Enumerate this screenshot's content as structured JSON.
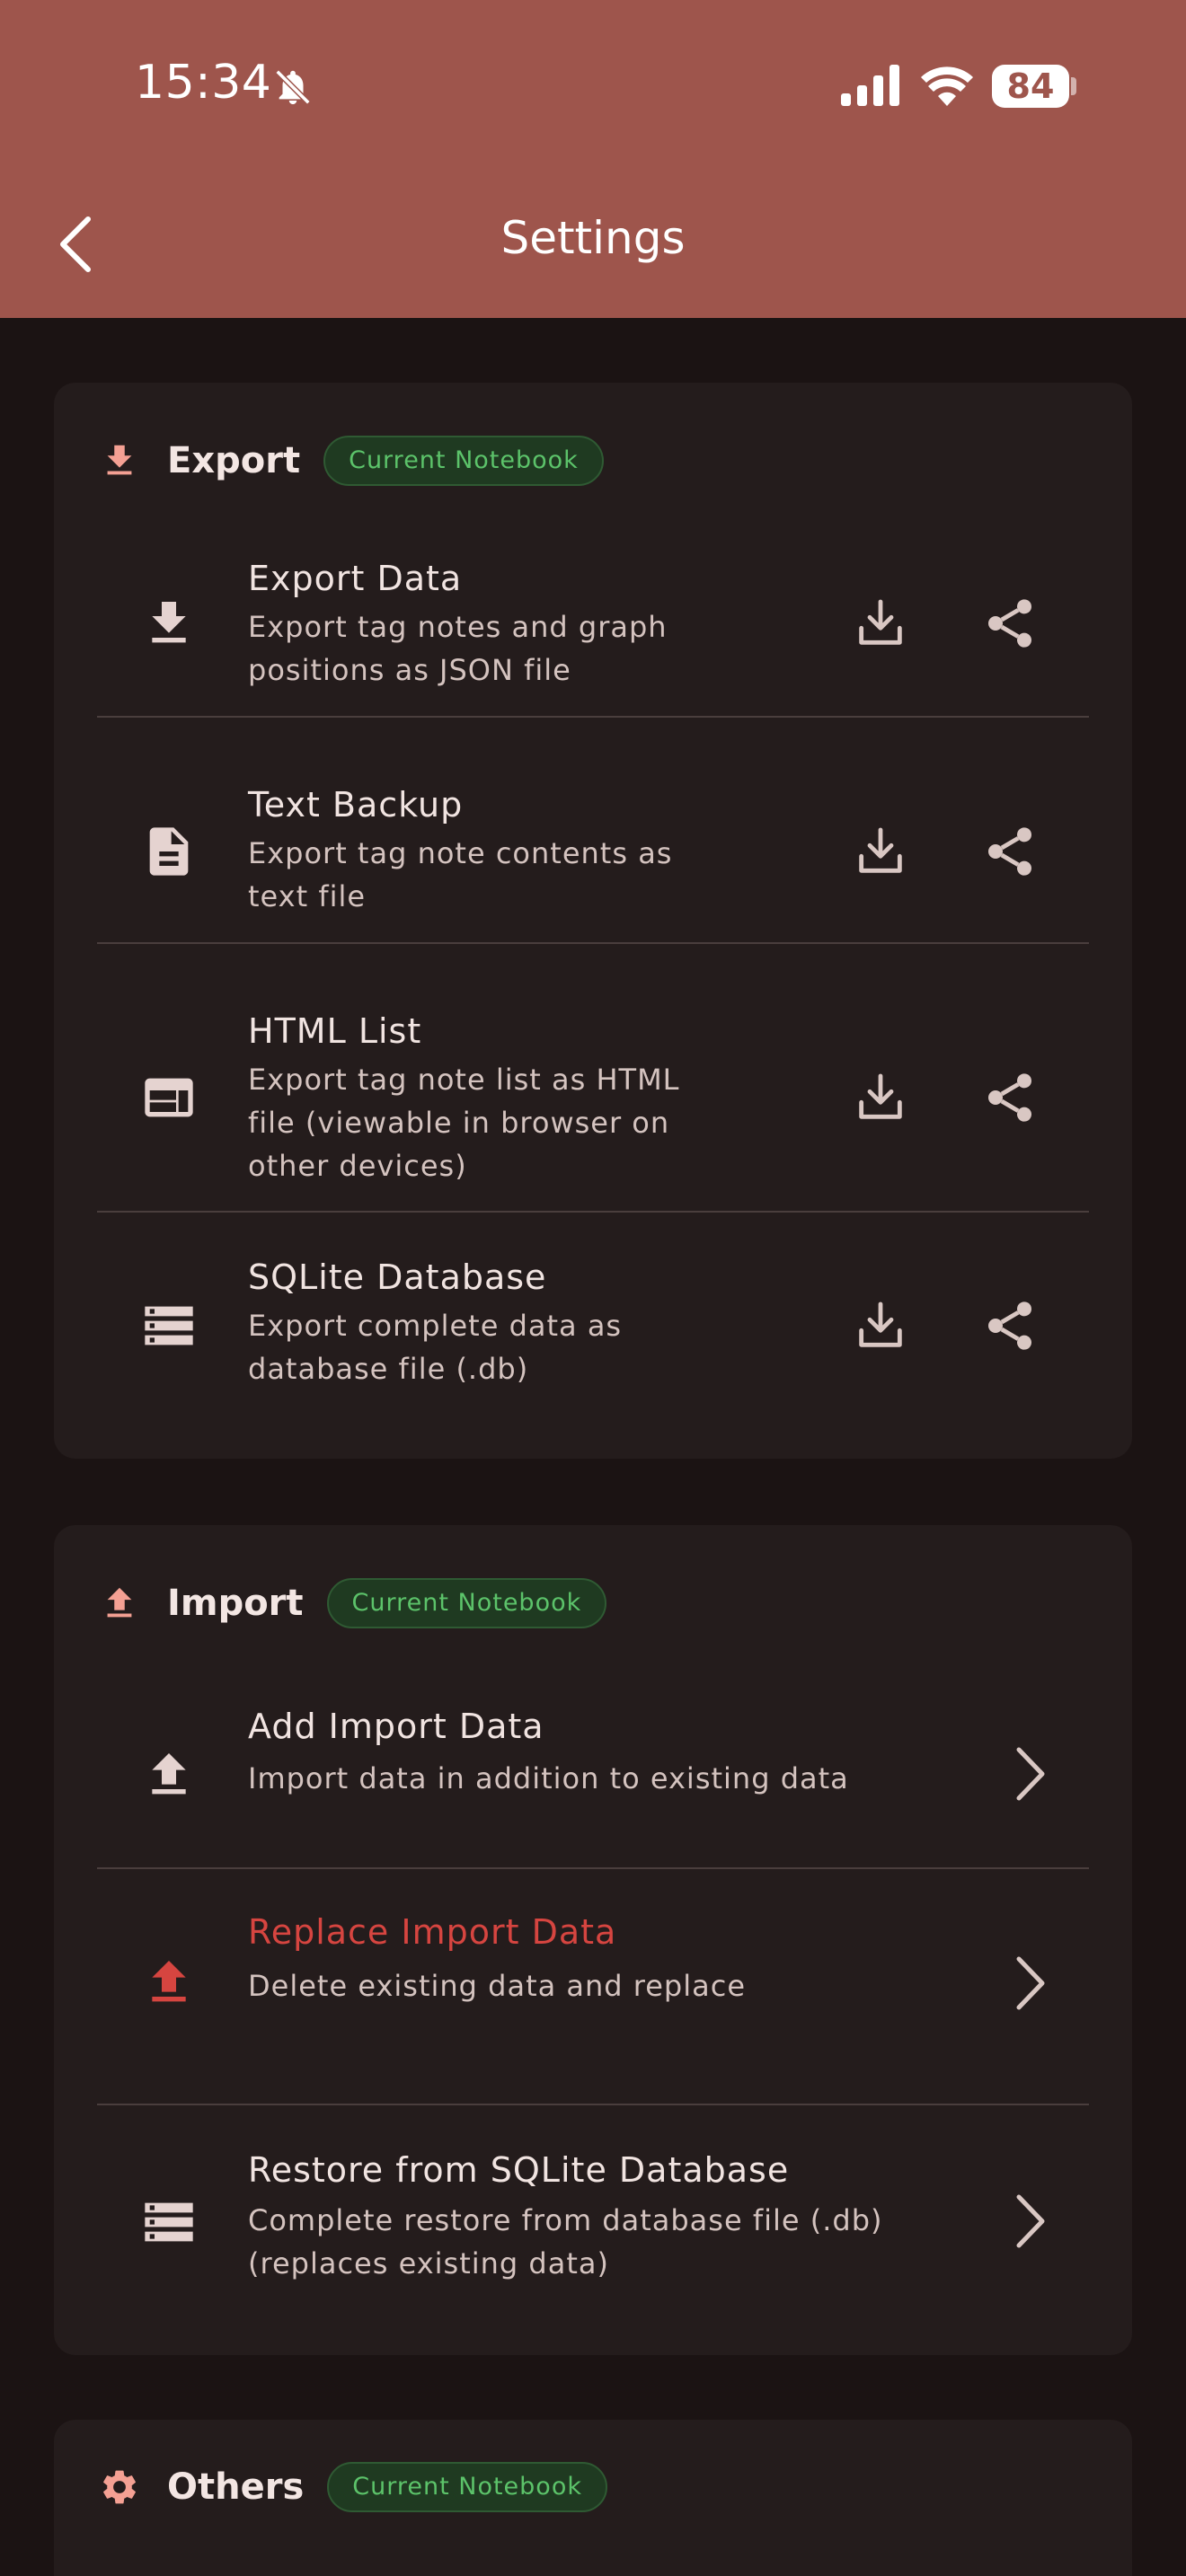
{
  "status": {
    "time": "15:34",
    "battery": "84"
  },
  "header": {
    "title": "Settings"
  },
  "export": {
    "title": "Export",
    "badge": "Current Notebook",
    "items": [
      {
        "title": "Export Data",
        "subtitle_lines": [
          "Export tag notes and graph",
          "positions as JSON file"
        ]
      },
      {
        "title": "Text Backup",
        "subtitle_lines": [
          "Export tag note contents as",
          "text file"
        ]
      },
      {
        "title": "HTML List",
        "subtitle_lines": [
          "Export tag note list as HTML",
          "file (viewable in browser on",
          "other devices)"
        ]
      },
      {
        "title": "SQLite Database",
        "subtitle_lines": [
          "Export complete data as",
          "database file (.db)"
        ]
      }
    ]
  },
  "import": {
    "title": "Import",
    "badge": "Current Notebook",
    "items": [
      {
        "title": "Add Import Data",
        "subtitle_lines": [
          "Import data in addition to existing data"
        ]
      },
      {
        "title": "Replace Import Data",
        "subtitle_lines": [
          "Delete existing data and replace"
        ]
      },
      {
        "title": "Restore from SQLite Database",
        "subtitle_lines": [
          "Complete restore from database file (.db)",
          "(replaces existing data)"
        ]
      }
    ]
  },
  "others": {
    "title": "Others",
    "badge": "Current Notebook"
  },
  "colors": {
    "header": "#9e554c",
    "background": "#1b1313",
    "card": "#241c1c",
    "accent_icon": "#f4a093",
    "danger": "#d64540",
    "badge_text": "#5cc36a"
  }
}
